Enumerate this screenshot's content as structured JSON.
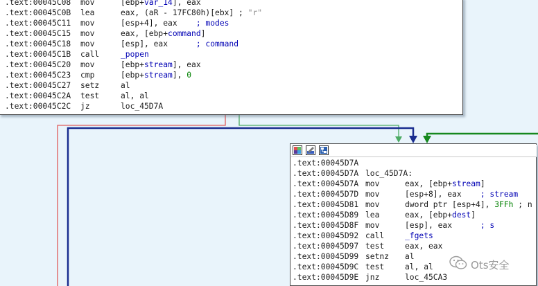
{
  "colors": {
    "background": "#e9f4fb",
    "edge_false": "#e05a5a",
    "edge_true": "#4caa64",
    "edge_jump": "#1a2d8f",
    "edge_green_bold": "#16881e"
  },
  "block1": {
    "lines": [
      {
        "addr": ".text:00045C08",
        "mnem": "mov",
        "parts": [
          {
            "t": "[ebp+"
          },
          {
            "t": "var_14",
            "c": "var"
          },
          {
            "t": "], eax"
          }
        ]
      },
      {
        "addr": ".text:00045C0B",
        "mnem": "lea",
        "parts": [
          {
            "t": "eax, (aR - 17FC80h)[ebx] ; "
          },
          {
            "t": "\"r\"",
            "c": "str"
          }
        ]
      },
      {
        "addr": ".text:00045C11",
        "mnem": "mov",
        "parts": [
          {
            "t": "[esp+4], eax    "
          },
          {
            "t": "; modes",
            "c": "cmt"
          }
        ]
      },
      {
        "addr": ".text:00045C15",
        "mnem": "mov",
        "parts": [
          {
            "t": "eax, [ebp+"
          },
          {
            "t": "command",
            "c": "var"
          },
          {
            "t": "]"
          }
        ]
      },
      {
        "addr": ".text:00045C18",
        "mnem": "mov",
        "parts": [
          {
            "t": "[esp], eax      "
          },
          {
            "t": "; command",
            "c": "cmt"
          }
        ]
      },
      {
        "addr": ".text:00045C1B",
        "mnem": "call",
        "parts": [
          {
            "t": "_popen",
            "c": "var"
          }
        ]
      },
      {
        "addr": ".text:00045C20",
        "mnem": "mov",
        "parts": [
          {
            "t": "[ebp+"
          },
          {
            "t": "stream",
            "c": "var"
          },
          {
            "t": "], eax"
          }
        ]
      },
      {
        "addr": ".text:00045C23",
        "mnem": "cmp",
        "parts": [
          {
            "t": "[ebp+"
          },
          {
            "t": "stream",
            "c": "var"
          },
          {
            "t": "], "
          },
          {
            "t": "0",
            "c": "num"
          }
        ]
      },
      {
        "addr": ".text:00045C27",
        "mnem": "setz",
        "parts": [
          {
            "t": "al"
          }
        ]
      },
      {
        "addr": ".text:00045C2A",
        "mnem": "test",
        "parts": [
          {
            "t": "al, al"
          }
        ]
      },
      {
        "addr": ".text:00045C2C",
        "mnem": "jz",
        "parts": [
          {
            "t": "loc_45D7A"
          }
        ]
      }
    ]
  },
  "block2": {
    "title_icons": [
      "palette-icon",
      "rename-icon",
      "graph-icon"
    ],
    "lines": [
      {
        "addr": ".text:00045D7A",
        "mnem": "",
        "parts": []
      },
      {
        "addr": ".text:00045D7A",
        "label": "loc_45D7A:"
      },
      {
        "addr": ".text:00045D7A",
        "mnem": "mov",
        "parts": [
          {
            "t": "eax, [ebp+"
          },
          {
            "t": "stream",
            "c": "var"
          },
          {
            "t": "]"
          }
        ]
      },
      {
        "addr": ".text:00045D7D",
        "mnem": "mov",
        "parts": [
          {
            "t": "[esp+8], eax    "
          },
          {
            "t": "; stream",
            "c": "cmt"
          }
        ]
      },
      {
        "addr": ".text:00045D81",
        "mnem": "mov",
        "parts": [
          {
            "t": "dword ptr [esp+4], "
          },
          {
            "t": "3FFh",
            "c": "num"
          },
          {
            "t": " ; n"
          }
        ]
      },
      {
        "addr": ".text:00045D89",
        "mnem": "lea",
        "parts": [
          {
            "t": "eax, [ebp+"
          },
          {
            "t": "dest",
            "c": "var"
          },
          {
            "t": "]"
          }
        ]
      },
      {
        "addr": ".text:00045D8F",
        "mnem": "mov",
        "parts": [
          {
            "t": "[esp], eax      "
          },
          {
            "t": "; s",
            "c": "cmt"
          }
        ]
      },
      {
        "addr": ".text:00045D92",
        "mnem": "call",
        "parts": [
          {
            "t": "_fgets",
            "c": "var"
          }
        ]
      },
      {
        "addr": ".text:00045D97",
        "mnem": "test",
        "parts": [
          {
            "t": "eax, eax"
          }
        ]
      },
      {
        "addr": ".text:00045D99",
        "mnem": "setnz",
        "parts": [
          {
            "t": "al"
          }
        ]
      },
      {
        "addr": ".text:00045D9C",
        "mnem": "test",
        "parts": [
          {
            "t": "al, al"
          }
        ]
      },
      {
        "addr": ".text:00045D9E",
        "mnem": "jnz",
        "parts": [
          {
            "t": "loc_45CA3"
          }
        ]
      }
    ]
  },
  "watermark": {
    "text": "Ots安全",
    "icon": "wechat-icon"
  }
}
